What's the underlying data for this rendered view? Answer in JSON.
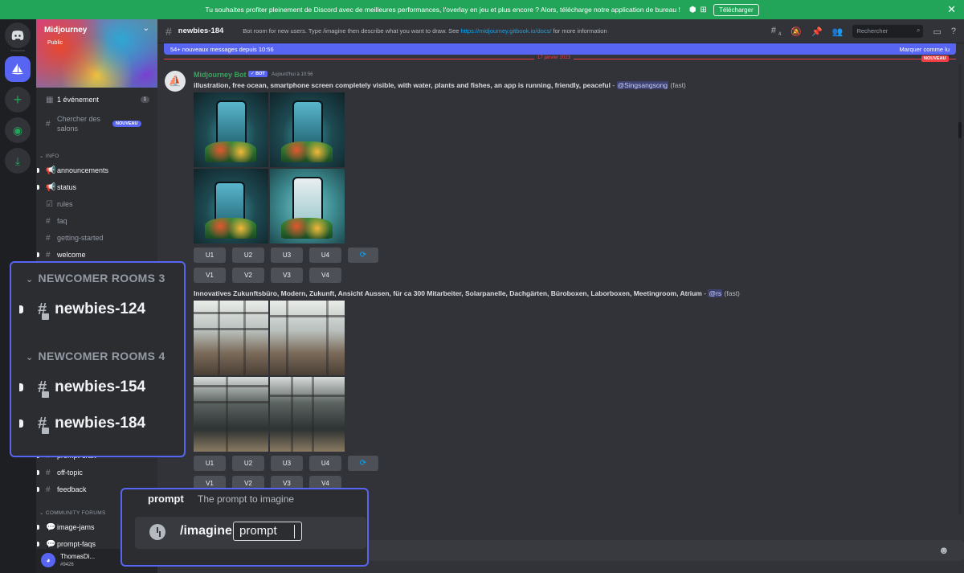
{
  "notice": {
    "text": "Tu souhaites profiter pleinement de Discord avec de meilleures performances, l'overlay en jeu et plus encore ? Alors, télécharge notre application de bureau !",
    "download_label": "Télécharger",
    "os_icons": [
      "apple-icon",
      "android-icon",
      "windows-icon"
    ]
  },
  "server": {
    "name": "Midjourney",
    "visibility": "Public"
  },
  "sidebar": {
    "events": {
      "label": "1 événement",
      "count": "1"
    },
    "browse": {
      "label": "Chercher des salons",
      "badge": "NOUVEAU"
    },
    "category_info": "INFO",
    "info_channels": [
      {
        "label": "announcements",
        "icon": "megaphone-icon",
        "bright": true
      },
      {
        "label": "status",
        "icon": "megaphone-icon",
        "bright": true
      },
      {
        "label": "rules",
        "icon": "rules-icon",
        "bright": false
      },
      {
        "label": "faq",
        "icon": "hash-icon",
        "bright": false
      },
      {
        "label": "getting-started",
        "icon": "hash-icon",
        "bright": false
      },
      {
        "label": "welcome",
        "icon": "hash-icon",
        "bright": true
      }
    ],
    "lower_channels": [
      {
        "label": "prompt-craft",
        "icon": "hash-icon"
      },
      {
        "label": "off-topic",
        "icon": "hash-icon"
      },
      {
        "label": "feedback",
        "icon": "hash-icon"
      }
    ],
    "category_forums": "COMMUNITY FORUMS",
    "forum_channels": [
      {
        "label": "image-jams",
        "icon": "forum-icon"
      },
      {
        "label": "prompt-faqs",
        "icon": "forum-icon"
      }
    ]
  },
  "user": {
    "name": "ThomasDi...",
    "tag": "#9426"
  },
  "header": {
    "channel": "newbies-184",
    "topic_text": "Bot room for new users. Type /imagine then describe what you want to draw. See",
    "topic_link": "https://midjourney.gitbook.io/docs/",
    "topic_after": "for more information",
    "thread_count": "4",
    "search_placeholder": "Rechercher"
  },
  "new_messages": {
    "text": "54+ nouveaux messages depuis 10:56",
    "mark_read": "Marquer comme lu"
  },
  "date_divider": "17 janvier 2023",
  "new_badge": "NOUVEAU",
  "message": {
    "author": "Midjourney Bot",
    "bot_badge": "✓ BOT",
    "timestamp": "Aujourd'hui à 10:56",
    "jobs": [
      {
        "prompt": "illustration, free ocean, smartphone screen completely visible, with water, plants and fishes, an app is running, friendly, peaceful",
        "mention": "@Singsangsong",
        "mode": "(fast)"
      },
      {
        "prompt": "Innovatives Zukunftsbüro, Modern, Zukunft, Ansicht Aussen, für ca 300 Mitarbeiter, Solarpanelle, Dachgärten, Büroboxen, Laborboxen, Meetingroom, Atrium",
        "mention": "@rs",
        "mode": "(fast)"
      }
    ],
    "upscale_buttons": [
      "U1",
      "U2",
      "U3",
      "U4"
    ],
    "variation_buttons": [
      "V1",
      "V2",
      "V3",
      "V4"
    ]
  },
  "zoom_channels": {
    "cat1": "NEWCOMER ROOMS 3",
    "ch1": "newbies-124",
    "cat2": "NEWCOMER ROOMS 4",
    "ch2": "newbies-154",
    "ch3": "newbies-184"
  },
  "zoom_command": {
    "param_name": "prompt",
    "param_desc": "The prompt to imagine",
    "command": "/imagine",
    "option": "prompt"
  },
  "colors": {
    "accent": "#5865f2",
    "notice_green": "#23a559",
    "bot_name_green": "#3ba55d",
    "new_red": "#f23f43"
  }
}
